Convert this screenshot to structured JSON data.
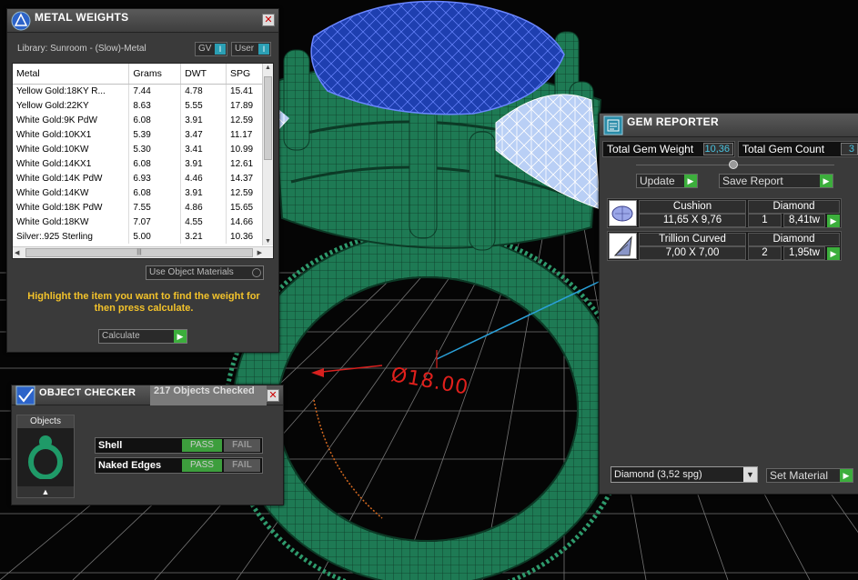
{
  "metal_weights": {
    "title": "METAL WEIGHTS",
    "library_label": "Library: Sunroom - (Slow)-Metal",
    "gv_label": "GV",
    "user_label": "User",
    "columns": [
      "Metal",
      "Grams",
      "DWT",
      "SPG"
    ],
    "rows": [
      [
        "Yellow Gold:18KY R...",
        "7.44",
        "4.78",
        "15.41"
      ],
      [
        "Yellow Gold:22KY",
        "8.63",
        "5.55",
        "17.89"
      ],
      [
        "White Gold:9K PdW",
        "6.08",
        "3.91",
        "12.59"
      ],
      [
        "White Gold:10KX1",
        "5.39",
        "3.47",
        "11.17"
      ],
      [
        "White Gold:10KW",
        "5.30",
        "3.41",
        "10.99"
      ],
      [
        "White Gold:14KX1",
        "6.08",
        "3.91",
        "12.61"
      ],
      [
        "White Gold:14K PdW",
        "6.93",
        "4.46",
        "14.37"
      ],
      [
        "White Gold:14KW",
        "6.08",
        "3.91",
        "12.59"
      ],
      [
        "White Gold:18K PdW",
        "7.55",
        "4.86",
        "15.65"
      ],
      [
        "White Gold:18KW",
        "7.07",
        "4.55",
        "14.66"
      ],
      [
        "Silver:.925 Sterling",
        "5.00",
        "3.21",
        "10.36"
      ]
    ],
    "use_object_materials": "Use Object Materials",
    "hint": "Highlight the item you want to find the weight for then press calculate.",
    "calculate_label": "Calculate"
  },
  "object_checker": {
    "title": "OBJECT CHECKER",
    "count_text": "217  Objects Checked",
    "objects_label": "Objects",
    "checks": [
      {
        "name": "Shell",
        "pass": "PASS",
        "fail": "FAIL"
      },
      {
        "name": "Naked Edges",
        "pass": "PASS",
        "fail": "FAIL"
      }
    ]
  },
  "gem_reporter": {
    "title": "GEM REPORTER",
    "total_weight_label": "Total Gem Weight",
    "total_weight_value": "10,36",
    "total_count_label": "Total Gem Count",
    "total_count_value": "3",
    "update_label": "Update",
    "save_report_label": "Save Report",
    "gems": [
      {
        "cut": "Cushion",
        "material": "Diamond",
        "size": "11,65 X 9,76",
        "qty": "1",
        "weight": "8,41tw"
      },
      {
        "cut": "Trillion Curved",
        "material": "Diamond",
        "size": "7,00 X 7,00",
        "qty": "2",
        "weight": "1,95tw"
      }
    ],
    "material_select": "Diamond     (3,52 spg)",
    "set_material_label": "Set Material"
  },
  "viewport": {
    "dimension_text": "Ø18.00"
  },
  "colors": {
    "ring_green": "#1f7a55",
    "gem_blue": "#1f3fae",
    "accent_green": "#3cae3c",
    "hint_yellow": "#f2c22b",
    "dimension_red": "#d8201e"
  }
}
